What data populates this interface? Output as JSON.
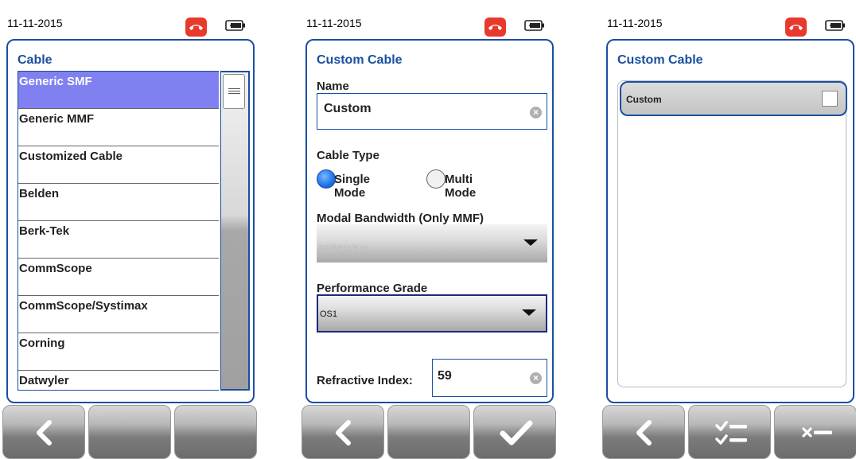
{
  "screens": [
    {
      "date": "11-11-2015",
      "title": "Cable",
      "cables": [
        "Generic SMF",
        "Generic MMF",
        "Customized Cable",
        "Belden",
        "Berk-Tek",
        "CommScope",
        "CommScope/Systimax",
        "Corning",
        "Datwyler"
      ],
      "selected": "Generic SMF",
      "buttons": [
        "back-icon",
        "",
        ""
      ]
    },
    {
      "date": "11-11-2015",
      "title": "Custom Cable",
      "name_label": "Name",
      "name_value": "Custom",
      "cable_type_label": "Cable Type",
      "cable_type_options": [
        "Single Mode",
        "Multi Mode"
      ],
      "cable_type_selected": "Single Mode",
      "modal_bw_label": "Modal Bandwidth (Only MMF)",
      "modal_bw_value": "400MHz*Km",
      "perf_grade_label": "Performance Grade",
      "perf_grade_value": "OS1",
      "refractive_label": "Refractive Index:",
      "refractive_value": "59",
      "buttons": [
        "back-icon",
        "",
        "checkmark-icon"
      ]
    },
    {
      "date": "11-11-2015",
      "title": "Custom Cable",
      "items": [
        "Custom"
      ],
      "buttons": [
        "back-icon",
        "select-all-icon",
        "delete-icon"
      ]
    }
  ],
  "colors": {
    "accent_blue": "#1b4fa0",
    "selected_row": "#8080f0",
    "phone_red": "#e8392c",
    "radio_blue": "#1e73e8"
  }
}
